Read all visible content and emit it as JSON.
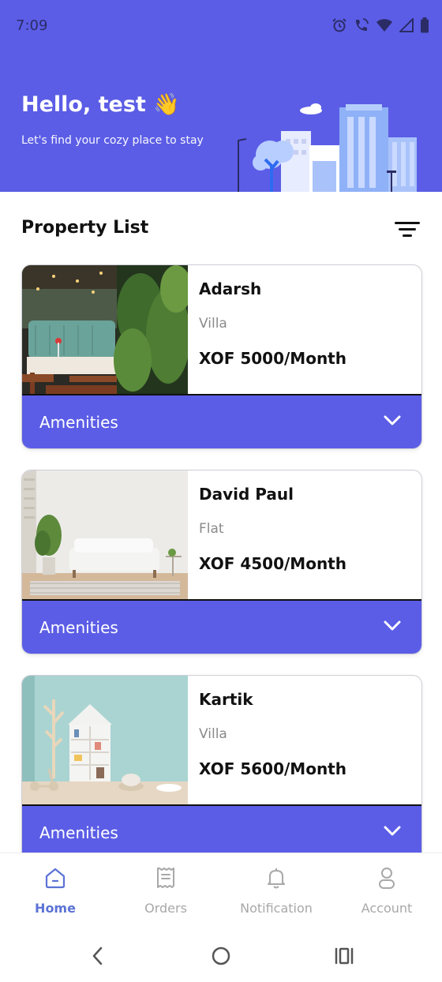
{
  "status_bar": {
    "time": "7:09"
  },
  "header": {
    "greeting": "Hello, test 👋",
    "subtitle": "Let's find your cozy place to stay",
    "background_color": "#5b5de6"
  },
  "section": {
    "title": "Property List"
  },
  "properties": [
    {
      "name": "Adarsh",
      "type": "Villa",
      "price": "XOF 5000/Month",
      "amenities_label": "Amenities"
    },
    {
      "name": "David Paul",
      "type": "Flat",
      "price": "XOF 4500/Month",
      "amenities_label": "Amenities"
    },
    {
      "name": "Kartik",
      "type": "Villa",
      "price": "XOF 5600/Month",
      "amenities_label": "Amenities"
    }
  ],
  "bottom_nav": {
    "items": [
      {
        "label": "Home",
        "icon": "home-icon",
        "active": true
      },
      {
        "label": "Orders",
        "icon": "receipt-icon",
        "active": false
      },
      {
        "label": "Notification",
        "icon": "bell-icon",
        "active": false
      },
      {
        "label": "Account",
        "icon": "person-icon",
        "active": false
      }
    ]
  },
  "colors": {
    "accent": "#5b5de6",
    "active_nav": "#5b73d6",
    "inactive_nav": "#a8a8a8"
  }
}
